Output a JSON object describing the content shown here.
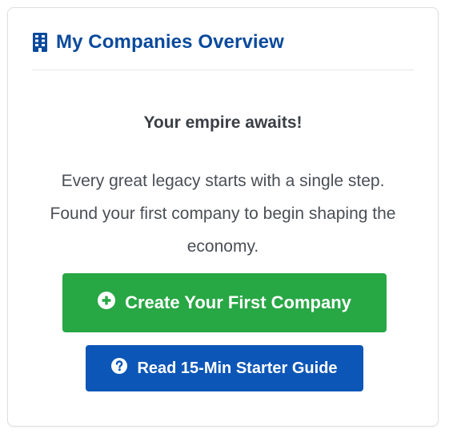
{
  "card": {
    "title": "My Companies Overview",
    "title_icon": "building-icon",
    "accent_color": "#0a4a9c"
  },
  "empty_state": {
    "headline": "Your empire awaits!",
    "description": "Every great legacy starts with a single step. Found your first company to begin shaping the economy."
  },
  "actions": {
    "create_label": "Create Your First Company",
    "create_icon": "plus-circle-icon",
    "create_color": "#28a745",
    "guide_label": "Read 15-Min Starter Guide",
    "guide_icon": "question-circle-icon",
    "guide_color": "#0c56b7"
  }
}
